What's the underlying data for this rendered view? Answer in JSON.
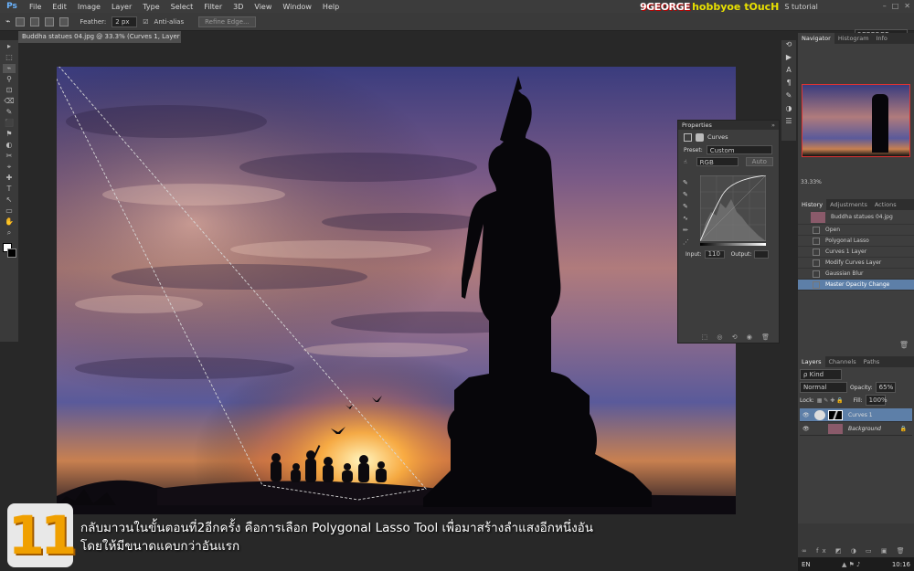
{
  "menu": {
    "logo": "Ps",
    "items": [
      "File",
      "Edit",
      "Image",
      "Layer",
      "Type",
      "Select",
      "Filter",
      "3D",
      "View",
      "Window",
      "Help"
    ]
  },
  "brand": {
    "part1": "9GEORGE",
    "part2": "hobbyoe tOucH",
    "part3": "S tutorial"
  },
  "workspace": "9GEORGE",
  "options": {
    "feather_label": "Feather:",
    "feather_value": "2 px",
    "antialias_label": "Anti-alias",
    "refine_label": "Refine Edge..."
  },
  "doc_tab": "Buddha statues 04.jpg @ 33.3% (Curves 1, Layer Mask/8) *",
  "tools": [
    "▸",
    "⬚",
    "⌁",
    "⚲",
    "⊡",
    "⌫",
    "✎",
    "⬛",
    "⚑",
    "◐",
    "✂",
    "⌖",
    "✚",
    "T",
    "↖",
    "▭",
    "✋",
    "⌕"
  ],
  "navigator": {
    "tabs": [
      "Navigator",
      "Histogram",
      "Info"
    ],
    "zoom": "33.33%"
  },
  "history": {
    "tabs": [
      "History",
      "Adjustments",
      "Actions"
    ],
    "snapshot": "Buddha statues 04.jpg",
    "items": [
      "Open",
      "Polygonal Lasso",
      "Curves 1 Layer",
      "Modify Curves Layer",
      "Gaussian Blur",
      "Master Opacity Change"
    ],
    "selected_index": 5
  },
  "properties": {
    "title": "Properties",
    "panel": "Curves",
    "preset_label": "Preset:",
    "preset_value": "Custom",
    "channel": "RGB",
    "auto": "Auto",
    "input_label": "Input:",
    "input_value": "110",
    "output_label": "Output:"
  },
  "layers": {
    "tabs": [
      "Layers",
      "Channels",
      "Paths"
    ],
    "kind": "ρ Kind",
    "blend": "Normal",
    "opacity_label": "Opacity:",
    "opacity_value": "65%",
    "lock_label": "Lock:",
    "fill_label": "Fill:",
    "fill_value": "100%",
    "rows": [
      {
        "name": "Curves 1",
        "selected": true
      },
      {
        "name": "Background",
        "selected": false
      }
    ]
  },
  "caption": {
    "number": "11",
    "line1": "กลับมาวนในขั้นตอนที่2อีกครั้ง คือการเลือก Polygonal Lasso Tool เพื่อมาสร้างลำแสงอีกหนึ่งอัน",
    "line2": "โดยให้มีขนาดแคบกว่าอันแรก"
  },
  "taskbar": {
    "lang": "EN",
    "time": "10:16"
  },
  "colors": {
    "accent": "#5d7fa8",
    "menu_bg": "#3c3c3c",
    "panel_bg": "#383838"
  }
}
